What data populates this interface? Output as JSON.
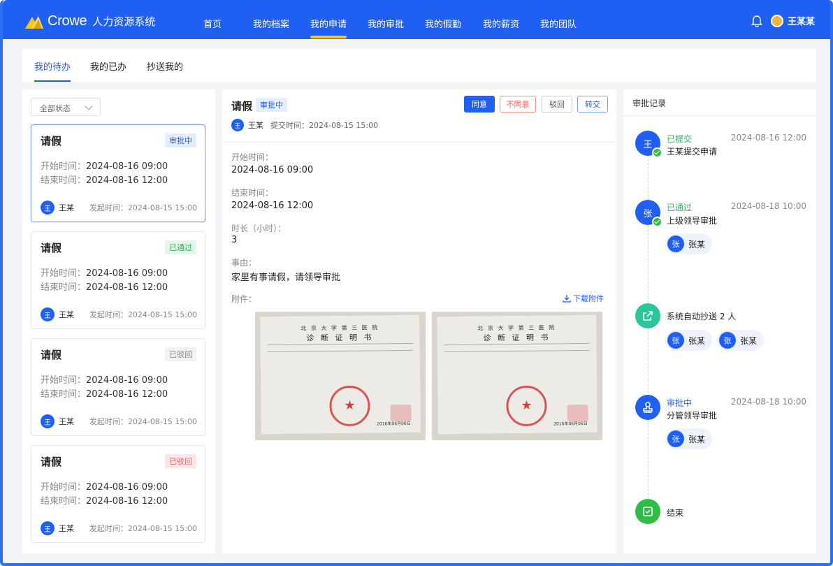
{
  "app": {
    "brand": "Crowe",
    "subtitle": "人力资源系统",
    "user": "王某某"
  },
  "colors": {
    "primary": "#1f5ff2",
    "accent": "#f5c518",
    "success": "#2fb45b",
    "danger": "#ef5a5a"
  },
  "nav": [
    {
      "label": "首页"
    },
    {
      "label": "我的档案"
    },
    {
      "label": "我的申请"
    },
    {
      "label": "我的审批"
    },
    {
      "label": "我的假勤"
    },
    {
      "label": "我的薪资"
    },
    {
      "label": "我的团队"
    }
  ],
  "nav_active": "我的申请",
  "tabs": [
    {
      "label": "我的待办"
    },
    {
      "label": "我的已办"
    },
    {
      "label": "抄送我的"
    }
  ],
  "filter": {
    "label": "全部状态"
  },
  "cards": [
    {
      "title": "请假",
      "status": "审批中",
      "start_label": "开始时间：",
      "start": "2024-08-16 09:00",
      "end_label": "结束时间：",
      "end": "2024-08-16 12:00",
      "avatar": "王",
      "name": "王某",
      "submit": "发起时间：2024-08-15 15:00"
    },
    {
      "title": "请假",
      "status": "已通过",
      "start_label": "开始时间：",
      "start": "2024-08-16 09:00",
      "end_label": "结束时间：",
      "end": "2024-08-16 12:00",
      "avatar": "王",
      "name": "王某",
      "submit": "发起时间：2024-08-15 15:00"
    },
    {
      "title": "请假",
      "status": "已驳回",
      "start_label": "开始时间：",
      "start": "2024-08-16 09:00",
      "end_label": "结束时间：",
      "end": "2024-08-16 12:00",
      "avatar": "王",
      "name": "王某",
      "submit": "发起时间：2024-08-15 15:00"
    },
    {
      "title": "请假",
      "status": "已驳回",
      "start_label": "开始时间：",
      "start": "2024-08-16 09:00",
      "end_label": "结束时间：",
      "end": "2024-08-16 12:00",
      "avatar": "王",
      "name": "王某",
      "submit": "发起时间：2024-08-15 15:00"
    }
  ],
  "detail": {
    "title": "请假",
    "status": "审批中",
    "avatar": "王",
    "name": "王某",
    "submit": "提交时间：2024-08-15 15:00",
    "buttons": {
      "agree": "同意",
      "disagree": "不同意",
      "reject": "驳回",
      "transfer": "转交"
    },
    "fields": [
      {
        "label": "开始时间：",
        "value": "2024-08-16 09:00"
      },
      {
        "label": "结束时间：",
        "value": "2024-08-16 12:00"
      },
      {
        "label": "时长（小时）：",
        "value": "3"
      },
      {
        "label": "事由：",
        "value": "家里有事请假，请领导审批"
      }
    ],
    "attachment_label": "附件：",
    "download": "下载附件",
    "attachment": {
      "hospital": "北 京 大 学 第 三 医 院",
      "doc_title": "诊 断 证 明 书",
      "date": "2016年06月06日"
    }
  },
  "records": {
    "title": "审批记录",
    "items": [
      {
        "avatar": "王",
        "status": "已提交",
        "desc": "王某提交申请",
        "time": "2024-08-16 12:00"
      },
      {
        "avatar": "张",
        "status": "已通过",
        "desc": "上级领导审批",
        "time": "2024-08-18 10:00",
        "chips": [
          {
            "avatar": "张",
            "name": "张某"
          }
        ]
      },
      {
        "status": "",
        "desc": "系统自动抄送 2 人",
        "chips": [
          {
            "avatar": "张",
            "name": "张某"
          },
          {
            "avatar": "张",
            "name": "张某"
          }
        ]
      },
      {
        "status": "审批中",
        "desc": "分管领导审批",
        "time": "2024-08-18 10:00",
        "chips": [
          {
            "avatar": "张",
            "name": "张某"
          }
        ]
      },
      {
        "status": "",
        "desc": "结束"
      }
    ]
  }
}
